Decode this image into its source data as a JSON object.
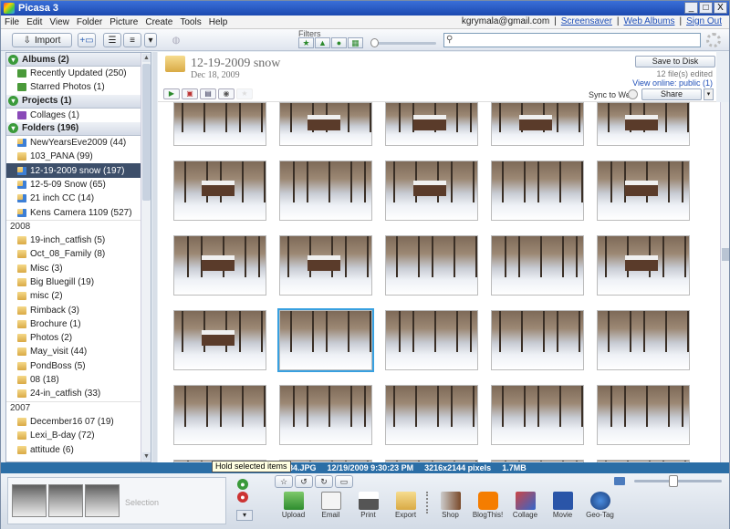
{
  "window": {
    "title": "Picasa 3",
    "minimize": "_",
    "maximize": "□",
    "close": "X"
  },
  "menu": [
    "File",
    "Edit",
    "View",
    "Folder",
    "Picture",
    "Create",
    "Tools",
    "Help"
  ],
  "account": {
    "email": "kgrymala@gmail.com",
    "sep": "|",
    "links": [
      "Screensaver",
      "Web Albums",
      "Sign Out"
    ]
  },
  "toolbar": {
    "import_label": "Import",
    "filters_label": "Filters",
    "search_placeholder": ""
  },
  "sections": {
    "albums": {
      "label": "Albums (2)",
      "items": [
        "Recently Updated (250)",
        "Starred Photos (1)"
      ]
    },
    "projects": {
      "label": "Projects (1)",
      "items": [
        "Collages (1)"
      ]
    },
    "folders": {
      "label": "Folders (196)",
      "items": [
        "NewYearsEve2009 (44)",
        "103_PANA (99)",
        "12-19-2009 snow (197)",
        "12-5-09 Snow (65)",
        "21 inch CC (14)",
        "Kens Camera 1109 (527)"
      ]
    },
    "y2008": {
      "label": "2008",
      "items": [
        "19-inch_catfish (5)",
        "Oct_08_Family (8)",
        "Misc (3)",
        "Big Bluegill (19)",
        "misc (2)",
        "Rimback (3)",
        "Brochure (1)",
        "Photos (2)",
        "May_visit (44)",
        "PondBoss (5)",
        "08 (18)",
        "24-in_catfish (33)"
      ]
    },
    "y2007": {
      "label": "2007",
      "items": [
        "December16 07 (19)",
        "Lexi_B-day (72)",
        "attitude (6)"
      ]
    }
  },
  "header": {
    "title": "12-19-2009 snow",
    "date": "Dec 18, 2009",
    "save_label": "Save to Disk",
    "file_info": "12 file(s) edited",
    "view_online": "View online: public (1)",
    "sync_label": "Sync to Web",
    "share_label": "Share"
  },
  "status": {
    "filename": "20984.JPG",
    "datetime": "12/19/2009 9:30:23 PM",
    "dimensions": "3216x2144 pixels",
    "size": "1.7MB"
  },
  "tooltip": "Hold selected items",
  "tray": {
    "selection_label": "Selection",
    "actions": [
      "Upload",
      "Email",
      "Print",
      "Export",
      "Shop",
      "BlogThis!",
      "Collage",
      "Movie",
      "Geo-Tag"
    ]
  },
  "colors": {
    "accent": "#2b6ea6",
    "selected_folder": "#3d4f6a",
    "link": "#1f4fb8",
    "thumb_outline": "#38a0e0"
  }
}
